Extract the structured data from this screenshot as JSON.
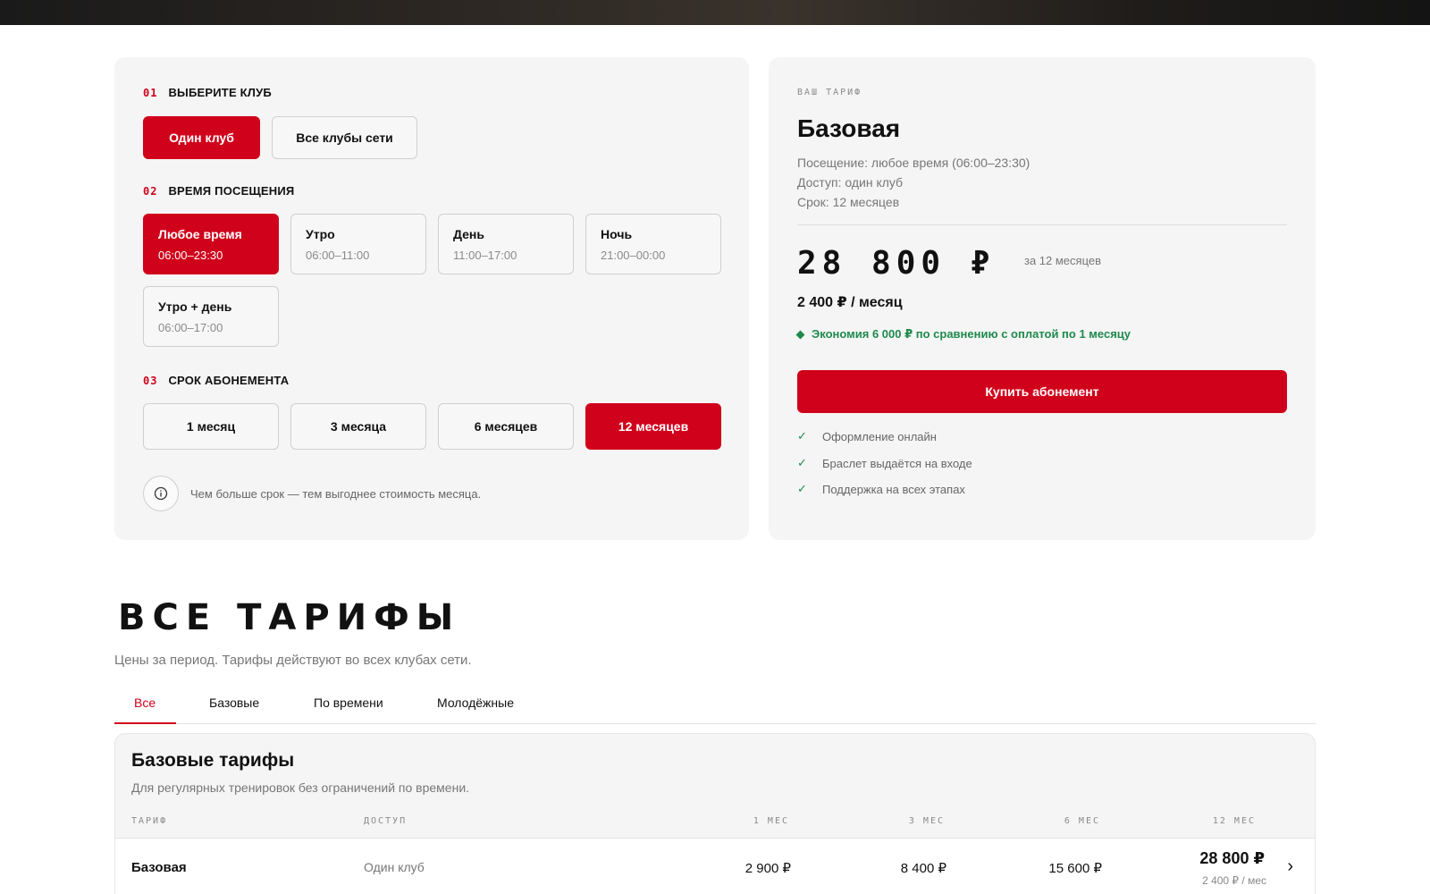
{
  "config": {
    "step1": {
      "num": "01",
      "label": "ВЫБЕРИТЕ КЛУБ"
    },
    "club_options": [
      {
        "label": "Один клуб",
        "active": true
      },
      {
        "label": "Все клубы сети",
        "active": false
      }
    ],
    "step2": {
      "num": "02",
      "label": "ВРЕМЯ ПОСЕЩЕНИЯ"
    },
    "time_options": [
      {
        "label": "Любое время",
        "hours": "06:00–23:30",
        "active": true
      },
      {
        "label": "Утро",
        "hours": "06:00–11:00",
        "active": false
      },
      {
        "label": "День",
        "hours": "11:00–17:00",
        "active": false
      },
      {
        "label": "Ночь",
        "hours": "21:00–00:00",
        "active": false
      },
      {
        "label": "Утро + день",
        "hours": "06:00–17:00",
        "active": false
      }
    ],
    "step3": {
      "num": "03",
      "label": "СРОК АБОНЕМЕНТА"
    },
    "term_options": [
      {
        "label": "1 месяц",
        "active": false
      },
      {
        "label": "3 месяца",
        "active": false
      },
      {
        "label": "6 месяцев",
        "active": false
      },
      {
        "label": "12 месяцев",
        "active": true
      }
    ],
    "info_text": "Чем больше срок — тем выгоднее стоимость месяца."
  },
  "summary": {
    "eyebrow": "ВАШ ТАРИФ",
    "plan_name": "Базовая",
    "details": [
      "Посещение: любое время (06:00–23:30)",
      "Доступ: один клуб",
      "Срок: 12 месяцев"
    ],
    "price": "28 800 ₽",
    "period": "за 12 месяцев",
    "monthly": "2 400 ₽ / месяц",
    "saving": "Экономия 6 000 ₽ по сравнению с оплатой по 1 месяцу",
    "buy_label": "Купить абонемент",
    "features": [
      "Оформление онлайн",
      "Браслет выдаётся на входе",
      "Поддержка на всех этапах"
    ]
  },
  "all_tariffs": {
    "title": "ВСЕ ТАРИФЫ",
    "subtitle": "Цены за период. Тарифы действуют во всех клубах сети.",
    "tabs": [
      {
        "label": "Все",
        "active": true
      },
      {
        "label": "Базовые",
        "active": false
      },
      {
        "label": "По времени",
        "active": false
      },
      {
        "label": "Молодёжные",
        "active": false
      }
    ]
  },
  "table": {
    "title": "Базовые тарифы",
    "subtitle": "Для регулярных тренировок без ограничений по времени.",
    "headers": {
      "tariff": "ТАРИФ",
      "access": "ДОСТУП",
      "m1": "1 МЕС",
      "m3": "3 МЕС",
      "m6": "6 МЕС",
      "m12": "12 МЕС"
    },
    "rows": [
      {
        "name": "Базовая",
        "access": "Один клуб",
        "m1": "2 900 ₽",
        "m3": "8 400 ₽",
        "m6": "15 600 ₽",
        "m12": "28 800 ₽",
        "m12_monthly": "2 400 ₽ / мес"
      }
    ]
  },
  "colors": {
    "accent": "#d0021b",
    "success": "#1e8a4c",
    "card_bg": "#f5f5f5"
  }
}
